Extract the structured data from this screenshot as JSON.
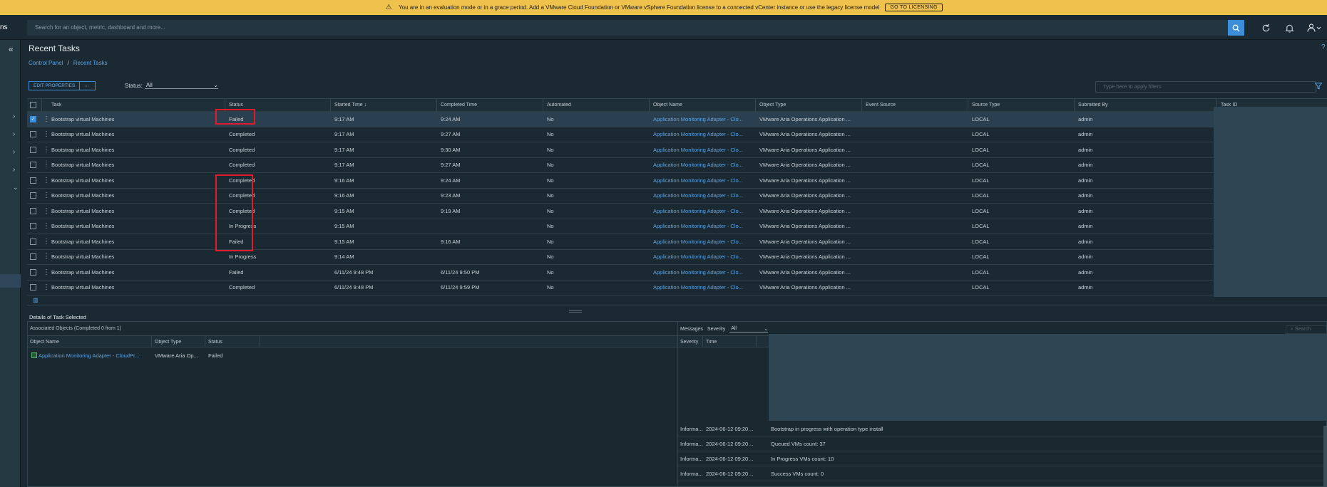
{
  "banner": {
    "message": "You are in an evaluation mode or in a grace period. Add a VMware Cloud Foundation or VMware vSphere Foundation license to a connected vCenter instance or use the legacy license model",
    "button": "GO TO LICENSING"
  },
  "topbar": {
    "brand": "ns",
    "search_placeholder": "Search for an object, metric, dashboard and more..."
  },
  "page": {
    "title": "Recent Tasks",
    "help": "?",
    "breadcrumb": [
      "Control Panel",
      "/",
      "Recent Tasks"
    ]
  },
  "toolbar": {
    "edit_properties": "EDIT PROPERTIES",
    "more": "⋯",
    "status_label": "Status:",
    "status_value": "All",
    "filter_placeholder": "Type here to apply filters"
  },
  "grid": {
    "columns": [
      "Task",
      "Status",
      "Started Time",
      "Completed Time",
      "Automated",
      "Object Name",
      "Object Type",
      "Event Source",
      "Source Type",
      "Submitted By",
      "Task ID"
    ],
    "sort_arrow": "↓",
    "rows": [
      {
        "task": "Bootstrap virtual Machines",
        "status": "Failed",
        "started": "9:17 AM",
        "completed": "9:24 AM",
        "automated": "No",
        "object_name": "Application Monitoring Adapter - Clo...",
        "object_type": "VMware Aria Operations Application ...",
        "event_source": "",
        "source_type": "LOCAL",
        "submitted_by": "admin",
        "checked": true
      },
      {
        "task": "Bootstrap virtual Machines",
        "status": "Completed",
        "started": "9:17 AM",
        "completed": "9:27 AM",
        "automated": "No",
        "object_name": "Application Monitoring Adapter - Clo...",
        "object_type": "VMware Aria Operations Application ...",
        "event_source": "",
        "source_type": "LOCAL",
        "submitted_by": "admin",
        "checked": false
      },
      {
        "task": "Bootstrap virtual Machines",
        "status": "Completed",
        "started": "9:17 AM",
        "completed": "9:30 AM",
        "automated": "No",
        "object_name": "Application Monitoring Adapter - Clo...",
        "object_type": "VMware Aria Operations Application ...",
        "event_source": "",
        "source_type": "LOCAL",
        "submitted_by": "admin",
        "checked": false
      },
      {
        "task": "Bootstrap virtual Machines",
        "status": "Completed",
        "started": "9:17 AM",
        "completed": "9:27 AM",
        "automated": "No",
        "object_name": "Application Monitoring Adapter - Clo...",
        "object_type": "VMware Aria Operations Application ...",
        "event_source": "",
        "source_type": "LOCAL",
        "submitted_by": "admin",
        "checked": false
      },
      {
        "task": "Bootstrap virtual Machines",
        "status": "Completed",
        "started": "9:16 AM",
        "completed": "9:24 AM",
        "automated": "No",
        "object_name": "Application Monitoring Adapter - Clo...",
        "object_type": "VMware Aria Operations Application ...",
        "event_source": "",
        "source_type": "LOCAL",
        "submitted_by": "admin",
        "checked": false
      },
      {
        "task": "Bootstrap virtual Machines",
        "status": "Completed",
        "started": "9:16 AM",
        "completed": "9:23 AM",
        "automated": "No",
        "object_name": "Application Monitoring Adapter - Clo...",
        "object_type": "VMware Aria Operations Application ...",
        "event_source": "",
        "source_type": "LOCAL",
        "submitted_by": "admin",
        "checked": false
      },
      {
        "task": "Bootstrap virtual Machines",
        "status": "Completed",
        "started": "9:15 AM",
        "completed": "9:19 AM",
        "automated": "No",
        "object_name": "Application Monitoring Adapter - Clo...",
        "object_type": "VMware Aria Operations Application ...",
        "event_source": "",
        "source_type": "LOCAL",
        "submitted_by": "admin",
        "checked": false
      },
      {
        "task": "Bootstrap virtual Machines",
        "status": "In Progress",
        "started": "9:15 AM",
        "completed": "",
        "automated": "No",
        "object_name": "Application Monitoring Adapter - Clo...",
        "object_type": "VMware Aria Operations Application ...",
        "event_source": "",
        "source_type": "LOCAL",
        "submitted_by": "admin",
        "checked": false
      },
      {
        "task": "Bootstrap virtual Machines",
        "status": "Failed",
        "started": "9:15 AM",
        "completed": "9:16 AM",
        "automated": "No",
        "object_name": "Application Monitoring Adapter - Clo...",
        "object_type": "VMware Aria Operations Application ...",
        "event_source": "",
        "source_type": "LOCAL",
        "submitted_by": "admin",
        "checked": false
      },
      {
        "task": "Bootstrap virtual Machines",
        "status": "In Progress",
        "started": "9:14 AM",
        "completed": "",
        "automated": "No",
        "object_name": "Application Monitoring Adapter - Clo...",
        "object_type": "VMware Aria Operations Application ...",
        "event_source": "",
        "source_type": "LOCAL",
        "submitted_by": "admin",
        "checked": false
      },
      {
        "task": "Bootstrap virtual Machines",
        "status": "Failed",
        "started": "6/11/24 9:48 PM",
        "completed": "6/11/24 9:50 PM",
        "automated": "No",
        "object_name": "Application Monitoring Adapter - Clo...",
        "object_type": "VMware Aria Operations Application ...",
        "event_source": "",
        "source_type": "LOCAL",
        "submitted_by": "admin",
        "checked": false
      },
      {
        "task": "Bootstrap virtual Machines",
        "status": "Completed",
        "started": "6/11/24 9:48 PM",
        "completed": "6/11/24 9:59 PM",
        "automated": "No",
        "object_name": "Application Monitoring Adapter - Clo...",
        "object_type": "VMware Aria Operations Application ...",
        "event_source": "",
        "source_type": "LOCAL",
        "submitted_by": "admin",
        "checked": false
      }
    ]
  },
  "details": {
    "title": "Details of Task Selected",
    "assoc_label": "Associated Objects (Completed 0 from 1)",
    "assoc_columns": [
      "Object Name",
      "Object Type",
      "Status"
    ],
    "assoc_rows": [
      {
        "name": "Application Monitoring Adapter - CloudPr...",
        "type": "VMware Aria Op...",
        "status": "Failed"
      }
    ],
    "messages_label": "Messages",
    "severity_label": "Severity",
    "severity_value": "All",
    "search_placeholder": "Search",
    "msg_columns": [
      "Severity",
      "Time"
    ],
    "msg_rows": [
      {
        "severity": "Informa...",
        "time": "2024-06-12 09:20:59...",
        "message": "Bootstrap in progress with operation type install"
      },
      {
        "severity": "Informa...",
        "time": "2024-06-12 09:20:59...",
        "message": "Queued VMs count: 37"
      },
      {
        "severity": "Informa...",
        "time": "2024-06-12 09:20:59...",
        "message": "In Progress VMs count: 10"
      },
      {
        "severity": "Informa...",
        "time": "2024-06-12 09:20:59...",
        "message": "Success VMs count: 0"
      }
    ]
  }
}
